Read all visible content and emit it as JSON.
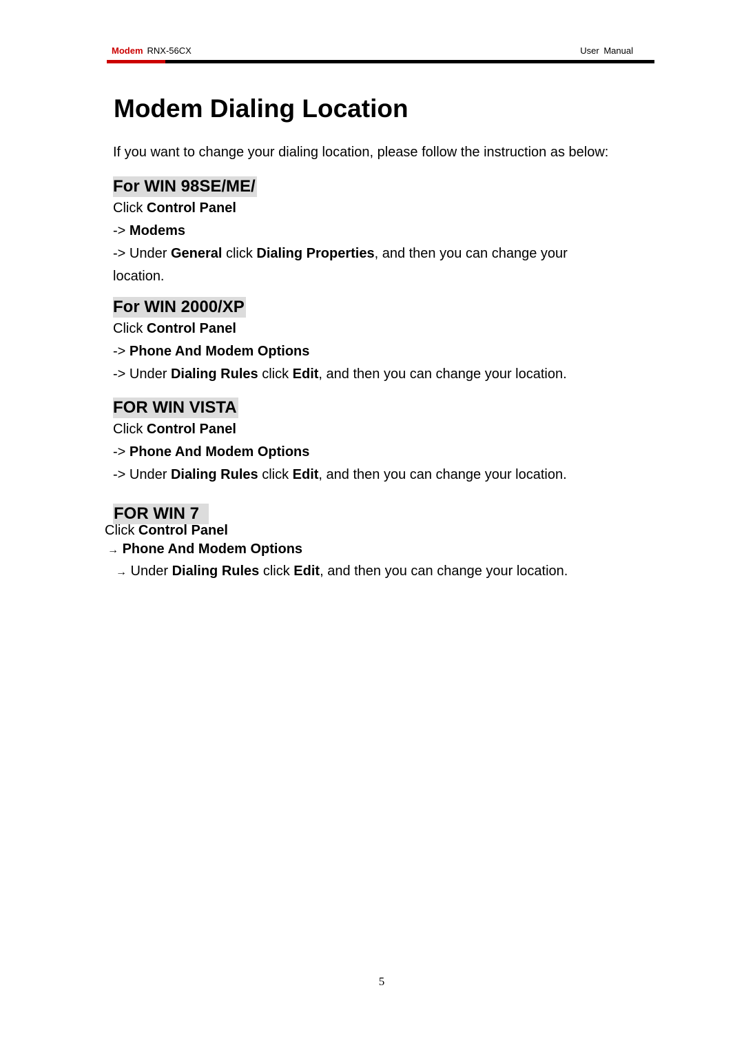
{
  "header": {
    "brand": "Modem",
    "model": "RNX-56CX",
    "doc_type": "User Manual",
    "colors": {
      "accent": "#cc0000",
      "rule": "#000000",
      "heading_bg": "#dcdcdc"
    }
  },
  "title": "Modem Dialing Location",
  "intro": "If you want to change your dialing location, please follow the instruction as below:",
  "sections": [
    {
      "title": "For WIN 98SE/ME/",
      "step1": {
        "pre": "Click ",
        "bold": "Control Panel"
      },
      "step2": {
        "arrow": "->",
        "bold": "Modems"
      },
      "step3": {
        "arrow": "->",
        "t1": " Under ",
        "b1": "General",
        "t2": " click ",
        "b2": "Dialing Properties",
        "t3": ", and then you can change your",
        "t4": "location."
      }
    },
    {
      "title": "For WIN 2000/XP",
      "step1": {
        "pre": "Click ",
        "bold": "Control Panel"
      },
      "step2": {
        "arrow": "->",
        "bold": "Phone And Modem Options"
      },
      "step3": {
        "arrow": "->",
        "t1": " Under ",
        "b1": "Dialing Rules",
        "t2": " click ",
        "b2": "Edit",
        "t3": ", and then you can change your location."
      }
    },
    {
      "title": "FOR WIN VISTA",
      "step1": {
        "pre": "Click ",
        "bold": "Control Panel"
      },
      "step2": {
        "arrow": "->",
        "bold": "Phone And Modem Options"
      },
      "step3": {
        "arrow": "->",
        "t1": " Under ",
        "b1": "Dialing Rules",
        "t2": " click ",
        "b2": "Edit",
        "t3": ", and then you can change your location."
      }
    },
    {
      "title": "FOR WIN 7",
      "step1": {
        "pre": "Click ",
        "bold": "Control Panel"
      },
      "step2": {
        "arrow": "→",
        "bold": "Phone And Modem Options"
      },
      "step3": {
        "arrow": "→",
        "t1": " Under ",
        "b1": "Dialing Rules",
        "t2": " click ",
        "b2": "Edit",
        "t3": ", and then you can change your location."
      }
    }
  ],
  "page_number": "5"
}
